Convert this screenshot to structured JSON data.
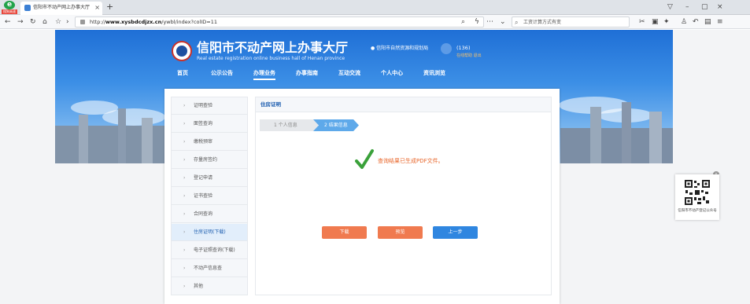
{
  "browser": {
    "logo_letter": "e",
    "logo_badge": "搜狗高速",
    "tab_title": "信阳市不动产网上办事大厅",
    "tab_close": "×",
    "new_tab": "+",
    "url_prefix": "http://",
    "url_host": "www.xysbdcdjzx.cn",
    "url_path": "/ywbl/index?colID=11",
    "search_placeholder": "工资计算方式有变",
    "win_min": "–",
    "win_max": "▢",
    "win_close": "×"
  },
  "site": {
    "title": "信阳市不动产网上办事大厅",
    "subtitle": "Real estate registration online business hall of Henan province",
    "location": "信阳市自然资源和规划局",
    "username": "(136)",
    "user_links": "在线帮助    退出"
  },
  "nav": [
    "首页",
    "公示公告",
    "办理业务",
    "办事指南",
    "互动交流",
    "个人中心",
    "资讯浏览"
  ],
  "nav_active_index": 2,
  "sidebar": {
    "items": [
      "证明查验",
      "面签查询",
      "缴税预审",
      "存量房签约",
      "登记申请",
      "证书查验",
      "合同查询",
      "住房证明(下载)",
      "电子证照查询(下载)",
      "不动产信息查",
      "其他"
    ],
    "active_index": 7
  },
  "content": {
    "header": "住房证明",
    "step1": "1  个人信息",
    "step2": "2  结果信息",
    "message": "查询结果已生成PDF文件。",
    "download_label": "下载",
    "preview_label": "预览",
    "prev_label": "上一步"
  },
  "qr": {
    "caption": "信阳市不动产登记公众号",
    "close": "×"
  },
  "colors": {
    "accent": "#2f86e0",
    "warning_button": "#f07a4f",
    "success_check": "#3aa13a"
  }
}
